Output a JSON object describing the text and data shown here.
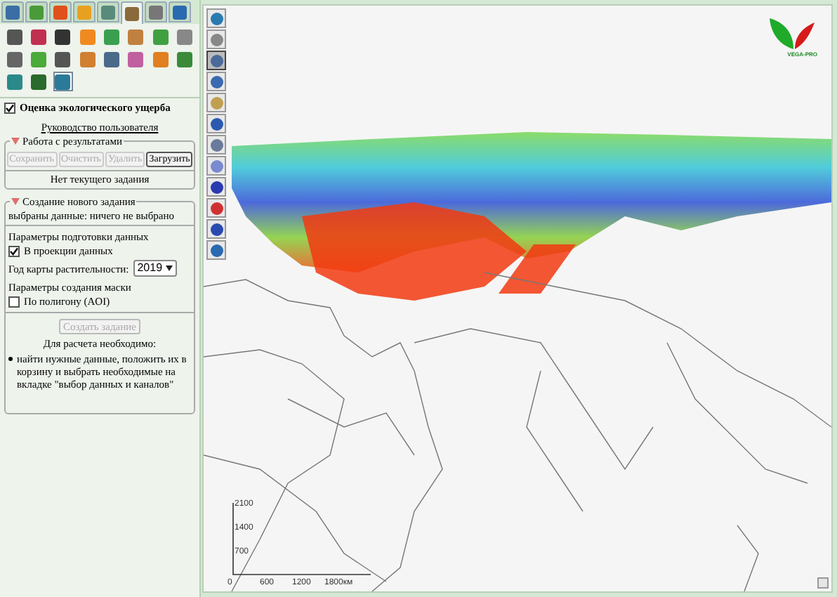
{
  "tabs": [
    {
      "selected": false
    },
    {
      "selected": false
    },
    {
      "selected": false
    },
    {
      "selected": false
    },
    {
      "selected": false
    },
    {
      "selected": true
    },
    {
      "selected": false
    },
    {
      "selected": false
    }
  ],
  "tools": [
    {
      "selected": false
    },
    {
      "selected": false
    },
    {
      "selected": false
    },
    {
      "selected": false
    },
    {
      "selected": false
    },
    {
      "selected": false
    },
    {
      "selected": false
    },
    {
      "selected": false
    },
    {
      "selected": false
    },
    {
      "selected": false
    },
    {
      "selected": false
    },
    {
      "selected": false
    },
    {
      "selected": false
    },
    {
      "selected": false
    },
    {
      "selected": false
    },
    {
      "selected": false
    },
    {
      "selected": false
    },
    {
      "selected": false
    },
    {
      "selected": true
    }
  ],
  "module": {
    "title": "Оценка экологического ущерба",
    "checked": true
  },
  "guide_link": "Руководство пользователя",
  "results": {
    "legend": "Работа с результатами",
    "buttons": [
      {
        "label": "Сохранить",
        "disabled": true
      },
      {
        "label": "Очистить",
        "disabled": true
      },
      {
        "label": "Удалить",
        "disabled": true
      },
      {
        "label": "Загрузить",
        "disabled": false
      }
    ],
    "status": "Нет текущего задания"
  },
  "new_task": {
    "legend": "Создание нового задания",
    "selected_data": "выбраны данные: ничего не выбрано",
    "prep_title": "Параметры подготовки данных",
    "projection": {
      "label": "В проекции данных",
      "checked": true
    },
    "year_label": "Год карты растительности:",
    "year": "2019",
    "mask_title": "Параметры создания маски",
    "polygon": {
      "label": "По полигону (AOI)",
      "checked": false
    },
    "create_button": {
      "label": "Создать задание",
      "disabled": true
    },
    "requirements_title": "Для расчета необходимо:",
    "requirements": [
      "найти нужные данные, положить их в корзину и выбрать необходимые на вкладке \"выбор данных и каналов\""
    ]
  },
  "map_tools": [
    {
      "selected": false
    },
    {
      "selected": false
    },
    {
      "selected": true
    },
    {
      "selected": false
    },
    {
      "selected": false
    },
    {
      "selected": false
    },
    {
      "selected": false
    },
    {
      "selected": false
    },
    {
      "selected": false
    },
    {
      "selected": false
    },
    {
      "selected": false
    },
    {
      "selected": false
    }
  ],
  "scale_bar": {
    "y_labels": [
      "2100",
      "1400",
      "700"
    ],
    "x_labels": [
      "0",
      "600",
      "1200",
      "1800км"
    ]
  },
  "logo": {
    "text": "VEGA-PRO"
  }
}
